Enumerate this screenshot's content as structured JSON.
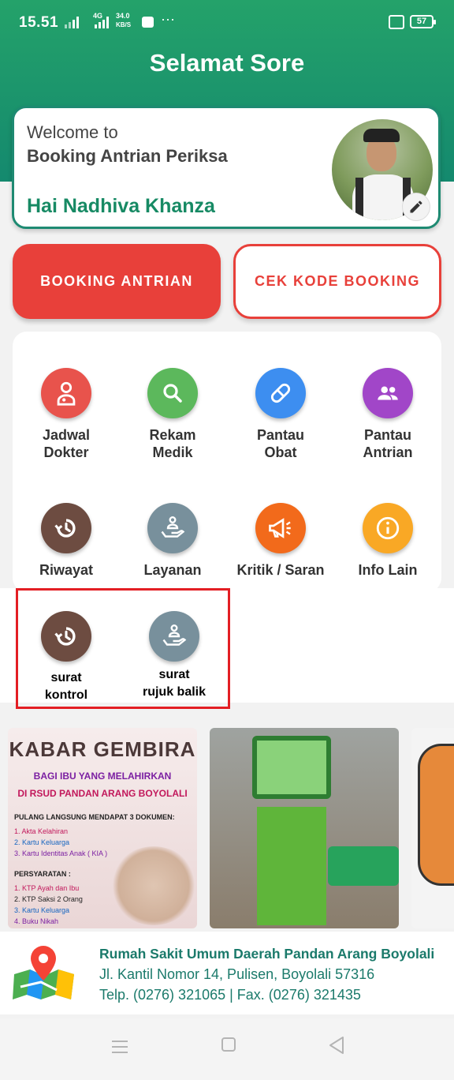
{
  "status_bar": {
    "time": "15.51",
    "net_type": "4G",
    "speed_value": "34.0",
    "speed_unit": "KB/S",
    "dots": "···",
    "battery": "57"
  },
  "header": {
    "greeting": "Selamat Sore"
  },
  "welcome_card": {
    "line1": "Welcome to",
    "line2": "Booking Antrian Periksa",
    "user_greeting": "Hai Nadhiva Khanza"
  },
  "actions": {
    "booking_label": "BOOKING ANTRIAN",
    "cek_label": "CEK KODE BOOKING"
  },
  "colors": {
    "primary_green": "#1e8a72",
    "accent_red": "#e8403a",
    "highlight_red": "#e31e24"
  },
  "menu": {
    "jadwal": {
      "label": "Jadwal\nDokter",
      "icon": "doctor-icon",
      "color": "#e8534c"
    },
    "rekam": {
      "label": "Rekam\nMedik",
      "icon": "search-icon",
      "color": "#5cb85c"
    },
    "obat": {
      "label": "Pantau\nObat",
      "icon": "pill-icon",
      "color": "#3d8ef0"
    },
    "antrian": {
      "label": "Pantau\nAntrian",
      "icon": "group-icon",
      "color": "#a146c8"
    },
    "riwayat": {
      "label": "Riwayat",
      "icon": "history-icon",
      "color": "#6d4c41"
    },
    "layanan": {
      "label": "Layanan",
      "icon": "hand-service-icon",
      "color": "#78909c"
    },
    "kritik": {
      "label": "Kritik / Saran",
      "icon": "megaphone-icon",
      "color": "#f26a1b"
    },
    "info": {
      "label": "Info Lain",
      "icon": "info-icon",
      "color": "#f9a825"
    },
    "kontrol": {
      "label": "surat\nkontrol",
      "icon": "history-icon",
      "color": "#6d4c41"
    },
    "rujuk": {
      "label": "surat\nrujuk balik",
      "icon": "hand-service-icon",
      "color": "#78909c"
    }
  },
  "banners": {
    "b1": {
      "title": "KABAR GEMBIRA",
      "sub1a": "BAGI IBU YANG MELAHIRKAN",
      "sub2a": "DI RSUD PANDAN ARANG BOYOLALI",
      "h1": "PULANG LANGSUNG MENDAPAT 3 DOKUMEN:",
      "docs": [
        "1. Akta Kelahiran",
        "2. Kartu Keluarga",
        "3. Kartu Identitas Anak ( KIA )"
      ],
      "h2": "PERSYARATAN :",
      "reqs": [
        "1. KTP Ayah dan Ibu",
        "2. KTP Saksi 2 Orang",
        "3. Kartu Keluarga",
        "4. Buku Nikah"
      ]
    }
  },
  "footer": {
    "name": "Rumah Sakit Umum Daerah Pandan Arang Boyolali",
    "address": "Jl. Kantil Nomor 14, Pulisen, Boyolali 57316",
    "telp": "Telp. (0276) 321065 | Fax. (0276) 321435"
  }
}
